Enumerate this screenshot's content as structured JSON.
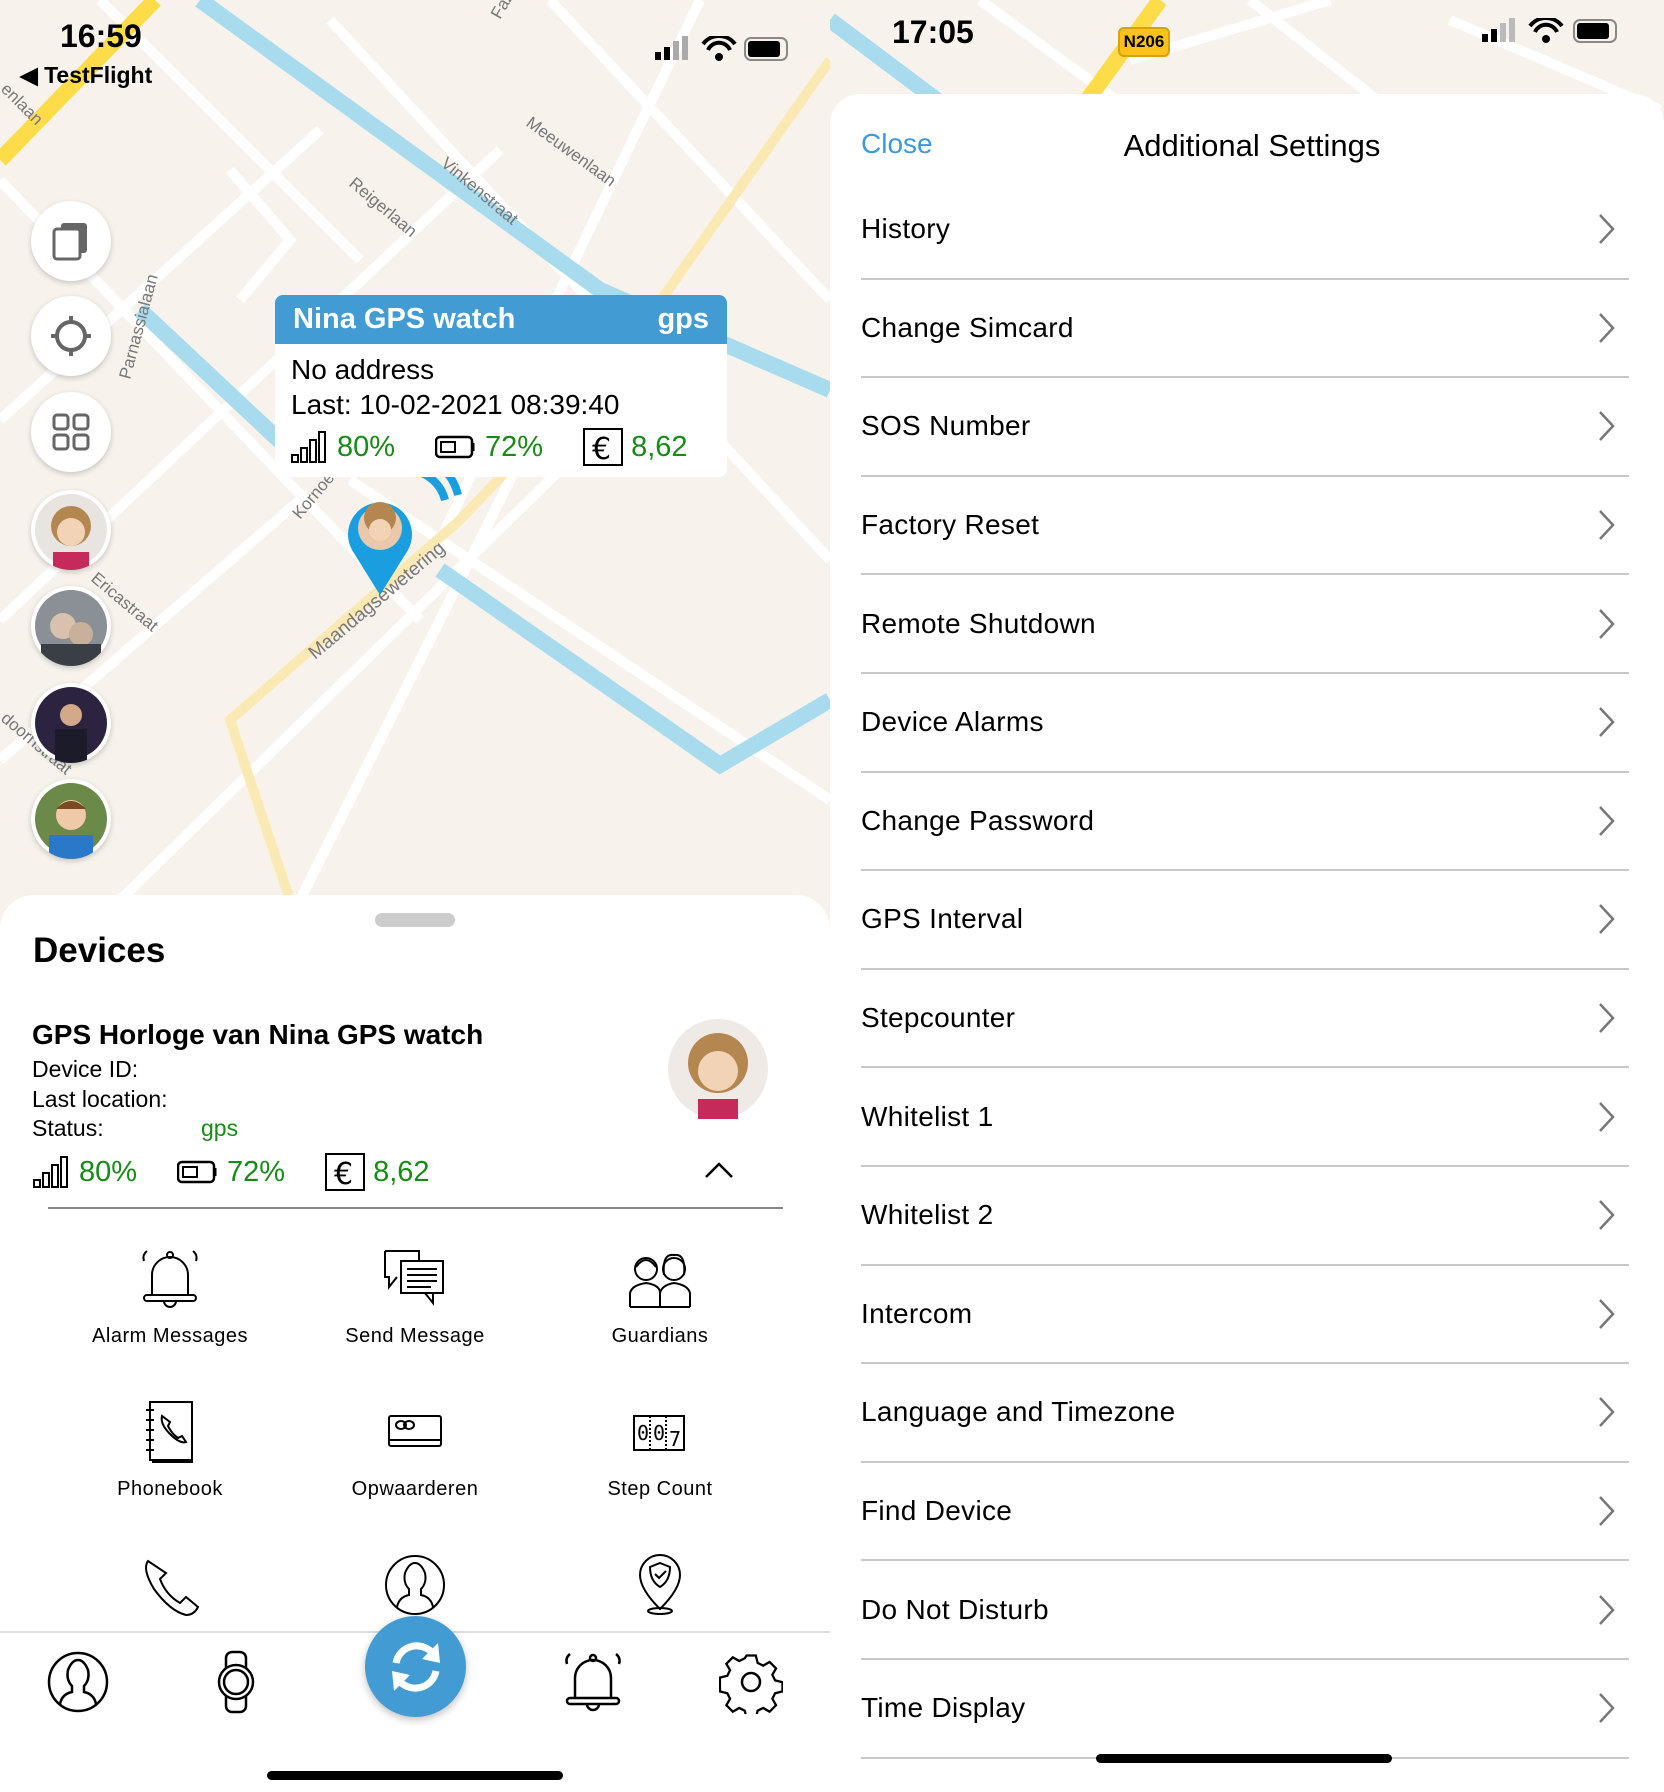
{
  "left": {
    "status_time": "16:59",
    "back_app": "TestFlight",
    "map_labels": [
      "Meeuwenlaan",
      "Vinkenstraat",
      "Reigerlaan",
      "Parnassialaan",
      "Ericastraat",
      "Maandagsewetering",
      "Kornoe",
      "doornstraat",
      "enlaan",
      "Faz"
    ],
    "map_buttons": [
      "layers-icon",
      "locate-icon",
      "grid-icon"
    ],
    "popup": {
      "title": "Nina GPS watch",
      "status": "gps",
      "address": "No address",
      "last": "Last: 10-02-2021 08:39:40",
      "signal": "80%",
      "battery": "72%",
      "credit": "8,62"
    },
    "sheet": {
      "title": "Devices",
      "device": {
        "name": "GPS Horloge van Nina GPS watch",
        "device_id_label": "Device ID:",
        "last_location_label": "Last location:",
        "status_label": "Status:",
        "status_value": "gps",
        "signal": "80%",
        "battery": "72%",
        "credit": "8,62"
      },
      "grid": [
        {
          "label": "Alarm Messages",
          "icon": "bell-icon"
        },
        {
          "label": "Send Message",
          "icon": "chat-icon"
        },
        {
          "label": "Guardians",
          "icon": "guardians-icon"
        },
        {
          "label": "Phonebook",
          "icon": "phonebook-icon"
        },
        {
          "label": "Opwaarderen",
          "icon": "card-icon"
        },
        {
          "label": "Step Count",
          "icon": "counter-icon"
        }
      ],
      "tabs": [
        "profile-icon",
        "watch-icon",
        "refresh-icon",
        "bell-icon",
        "gear-icon"
      ]
    },
    "colors": {
      "accent": "#439bd3",
      "green": "#188a18"
    }
  },
  "right": {
    "status_time": "17:05",
    "road_badge": "N206",
    "close": "Close",
    "title": "Additional Settings",
    "items": [
      "History",
      "Change Simcard",
      "SOS Number",
      "Factory Reset",
      "Remote Shutdown",
      "Device Alarms",
      "Change Password",
      "GPS Interval",
      "Stepcounter",
      "Whitelist 1",
      "Whitelist 2",
      "Intercom",
      "Language and Timezone",
      "Find Device",
      "Do Not Disturb",
      "Time Display"
    ],
    "accent": "#3b9ad9"
  }
}
